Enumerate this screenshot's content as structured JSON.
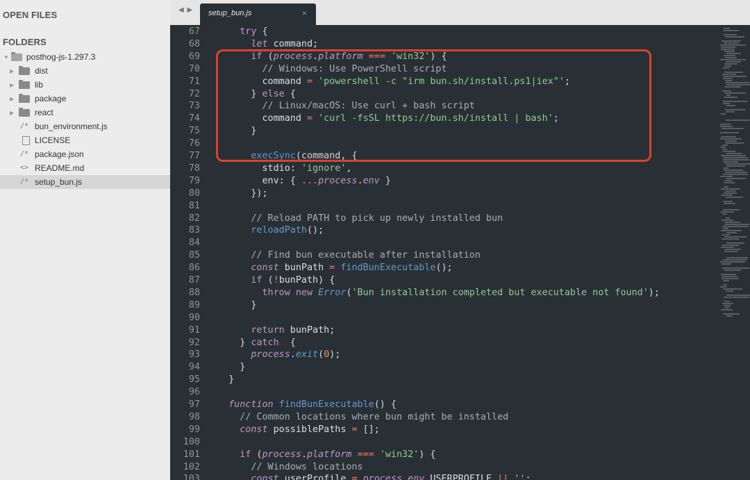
{
  "sidebar": {
    "open_files_label": "OPEN FILES",
    "folders_label": "FOLDERS",
    "root_folder": "posthog-js-1.297.3",
    "items": [
      {
        "label": "dist",
        "kind": "folder"
      },
      {
        "label": "lib",
        "kind": "folder"
      },
      {
        "label": "package",
        "kind": "folder"
      },
      {
        "label": "react",
        "kind": "folder"
      },
      {
        "label": "bun_environment.js",
        "kind": "js",
        "icon": "/*"
      },
      {
        "label": "LICENSE",
        "kind": "doc"
      },
      {
        "label": "package.json",
        "kind": "js",
        "icon": "/*"
      },
      {
        "label": "README.md",
        "kind": "md",
        "icon": "<>"
      },
      {
        "label": "setup_bun.js",
        "kind": "js",
        "icon": "/*",
        "selected": true
      }
    ]
  },
  "tabbar": {
    "nav_arrows": "◀ ▶",
    "tab_title": "setup_bun.js",
    "close_glyph": "×"
  },
  "editor": {
    "first_line_number": 67,
    "lines": [
      [
        [
          "    ",
          "punc"
        ],
        [
          "try",
          "kw"
        ],
        [
          " {",
          "punc"
        ]
      ],
      [
        [
          "      ",
          "punc"
        ],
        [
          "let",
          "kwi"
        ],
        [
          " command;",
          "var"
        ]
      ],
      [
        [
          "      ",
          "punc"
        ],
        [
          "if",
          "kw"
        ],
        [
          " (",
          "punc"
        ],
        [
          "process",
          "it"
        ],
        [
          ".",
          "punc"
        ],
        [
          "platform",
          "it"
        ],
        [
          " ",
          "punc"
        ],
        [
          "===",
          "op"
        ],
        [
          " ",
          "punc"
        ],
        [
          "'win32'",
          "str"
        ],
        [
          ") {",
          "punc"
        ]
      ],
      [
        [
          "        ",
          "punc"
        ],
        [
          "// Windows: Use PowerShell script",
          "cm"
        ]
      ],
      [
        [
          "        command ",
          "var"
        ],
        [
          "=",
          "op"
        ],
        [
          " ",
          "punc"
        ],
        [
          "'powershell -c \"irm bun.sh/install.ps1|iex\"'",
          "str"
        ],
        [
          ";",
          "punc"
        ]
      ],
      [
        [
          "      } ",
          "punc"
        ],
        [
          "else",
          "kw"
        ],
        [
          " {",
          "punc"
        ]
      ],
      [
        [
          "        ",
          "punc"
        ],
        [
          "// Linux/macOS: Use curl + bash script",
          "cm"
        ]
      ],
      [
        [
          "        command ",
          "var"
        ],
        [
          "=",
          "op"
        ],
        [
          " ",
          "punc"
        ],
        [
          "'curl -fsSL https://bun.sh/install | bash'",
          "str"
        ],
        [
          ";",
          "punc"
        ]
      ],
      [
        [
          "      }",
          "punc"
        ]
      ],
      [
        [
          "",
          "punc"
        ]
      ],
      [
        [
          "      ",
          "punc"
        ],
        [
          "execSync",
          "fn"
        ],
        [
          "(command, {",
          "punc"
        ]
      ],
      [
        [
          "        stdio: ",
          "var"
        ],
        [
          "'ignore'",
          "str"
        ],
        [
          ",",
          "punc"
        ]
      ],
      [
        [
          "        env: { ",
          "var"
        ],
        [
          "...",
          "op"
        ],
        [
          "process",
          "it"
        ],
        [
          ".",
          "punc"
        ],
        [
          "env",
          "it"
        ],
        [
          " }",
          "punc"
        ]
      ],
      [
        [
          "      });",
          "punc"
        ]
      ],
      [
        [
          "",
          "punc"
        ]
      ],
      [
        [
          "      ",
          "punc"
        ],
        [
          "// Reload PATH to pick up newly installed bun",
          "cm"
        ]
      ],
      [
        [
          "      ",
          "punc"
        ],
        [
          "reloadPath",
          "fn"
        ],
        [
          "();",
          "punc"
        ]
      ],
      [
        [
          "",
          "punc"
        ]
      ],
      [
        [
          "      ",
          "punc"
        ],
        [
          "// Find bun executable after installation",
          "cm"
        ]
      ],
      [
        [
          "      ",
          "punc"
        ],
        [
          "const",
          "kwi"
        ],
        [
          " bunPath ",
          "var"
        ],
        [
          "=",
          "op"
        ],
        [
          " ",
          "punc"
        ],
        [
          "findBunExecutable",
          "fn"
        ],
        [
          "();",
          "punc"
        ]
      ],
      [
        [
          "      ",
          "punc"
        ],
        [
          "if",
          "kw"
        ],
        [
          " (",
          "punc"
        ],
        [
          "!",
          "op"
        ],
        [
          "bunPath) {",
          "var"
        ]
      ],
      [
        [
          "        ",
          "punc"
        ],
        [
          "throw",
          "kw"
        ],
        [
          " ",
          "punc"
        ],
        [
          "new",
          "kw"
        ],
        [
          " ",
          "punc"
        ],
        [
          "Error",
          "cls"
        ],
        [
          "(",
          "punc"
        ],
        [
          "'Bun installation completed but executable not found'",
          "str"
        ],
        [
          ");",
          "punc"
        ]
      ],
      [
        [
          "      }",
          "punc"
        ]
      ],
      [
        [
          "",
          "punc"
        ]
      ],
      [
        [
          "      ",
          "punc"
        ],
        [
          "return",
          "kw"
        ],
        [
          " bunPath;",
          "var"
        ]
      ],
      [
        [
          "    } ",
          "punc"
        ],
        [
          "catch",
          "kw"
        ],
        [
          "  {",
          "punc"
        ]
      ],
      [
        [
          "      ",
          "punc"
        ],
        [
          "process",
          "it"
        ],
        [
          ".",
          "punc"
        ],
        [
          "exit",
          "fni"
        ],
        [
          "(",
          "punc"
        ],
        [
          "0",
          "num"
        ],
        [
          ");",
          "punc"
        ]
      ],
      [
        [
          "    }",
          "punc"
        ]
      ],
      [
        [
          "  }",
          "punc"
        ]
      ],
      [
        [
          "",
          "punc"
        ]
      ],
      [
        [
          "  ",
          "punc"
        ],
        [
          "function",
          "kwi"
        ],
        [
          " ",
          "punc"
        ],
        [
          "findBunExecutable",
          "fn"
        ],
        [
          "() {",
          "punc"
        ]
      ],
      [
        [
          "    ",
          "punc"
        ],
        [
          "// Common locations where bun might be installed",
          "cm"
        ]
      ],
      [
        [
          "    ",
          "punc"
        ],
        [
          "const",
          "kwi"
        ],
        [
          " possiblePaths ",
          "var"
        ],
        [
          "=",
          "op"
        ],
        [
          " [];",
          "punc"
        ]
      ],
      [
        [
          "",
          "punc"
        ]
      ],
      [
        [
          "    ",
          "punc"
        ],
        [
          "if",
          "kw"
        ],
        [
          " (",
          "punc"
        ],
        [
          "process",
          "it"
        ],
        [
          ".",
          "punc"
        ],
        [
          "platform",
          "it"
        ],
        [
          " ",
          "punc"
        ],
        [
          "===",
          "op"
        ],
        [
          " ",
          "punc"
        ],
        [
          "'win32'",
          "str"
        ],
        [
          ") {",
          "punc"
        ]
      ],
      [
        [
          "      ",
          "punc"
        ],
        [
          "// Windows locations",
          "cm"
        ]
      ],
      [
        [
          "      ",
          "punc"
        ],
        [
          "const",
          "kwi"
        ],
        [
          " userProfile ",
          "var"
        ],
        [
          "=",
          "op"
        ],
        [
          " ",
          "punc"
        ],
        [
          "process",
          "it"
        ],
        [
          ".",
          "punc"
        ],
        [
          "env",
          "it"
        ],
        [
          ".USERPROFILE ",
          "var"
        ],
        [
          "||",
          "op"
        ],
        [
          " ",
          "punc"
        ],
        [
          "''",
          "str"
        ],
        [
          ";",
          "punc"
        ]
      ]
    ]
  },
  "colors": {
    "editor_bg": "#283035",
    "sidebar_bg": "#ececec",
    "highlight_border": "#e0402d"
  }
}
